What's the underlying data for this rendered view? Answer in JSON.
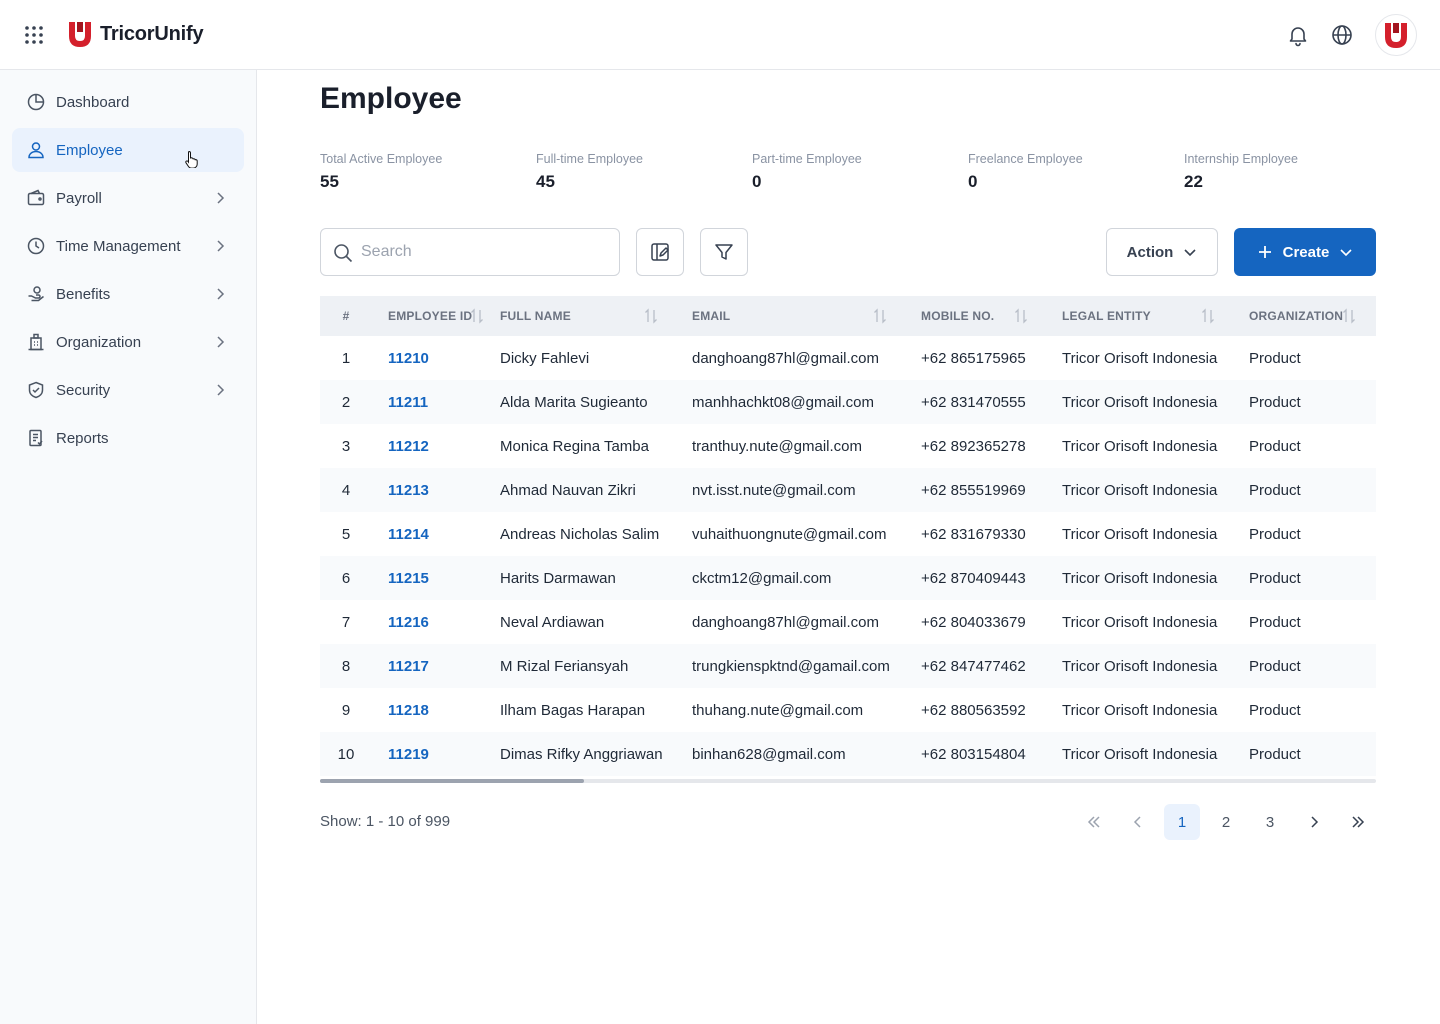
{
  "header": {
    "brand": "TricorUnify",
    "icons": [
      "apps-grid-icon",
      "bell-icon",
      "globe-icon",
      "avatar"
    ]
  },
  "sidebar": {
    "items": [
      {
        "label": "Dashboard",
        "icon": "dashboard-icon",
        "active": false,
        "has_children": false
      },
      {
        "label": "Employee",
        "icon": "user-icon",
        "active": true,
        "has_children": false
      },
      {
        "label": "Payroll",
        "icon": "wallet-icon",
        "active": false,
        "has_children": true
      },
      {
        "label": "Time Management",
        "icon": "clock-icon",
        "active": false,
        "has_children": true
      },
      {
        "label": "Benefits",
        "icon": "benefits-icon",
        "active": false,
        "has_children": true
      },
      {
        "label": "Organization",
        "icon": "building-icon",
        "active": false,
        "has_children": true
      },
      {
        "label": "Security",
        "icon": "shield-icon",
        "active": false,
        "has_children": true
      },
      {
        "label": "Reports",
        "icon": "report-icon",
        "active": false,
        "has_children": false
      }
    ]
  },
  "page": {
    "title": "Employee"
  },
  "stats": [
    {
      "label": "Total Active Employee",
      "value": "55"
    },
    {
      "label": "Full-time Employee",
      "value": "45"
    },
    {
      "label": "Part-time Employee",
      "value": "0"
    },
    {
      "label": "Freelance Employee",
      "value": "0"
    },
    {
      "label": "Internship Employee",
      "value": "22"
    }
  ],
  "toolbar": {
    "search_placeholder": "Search",
    "action_label": "Action",
    "create_label": "Create"
  },
  "table": {
    "headers": {
      "index": "#",
      "employee_id": "EMPLOYEE ID",
      "full_name": "FULL NAME",
      "email": "EMAIL",
      "mobile": "MOBILE NO.",
      "legal_entity": "LEGAL ENTITY",
      "organization": "ORGANIZATION"
    },
    "rows": [
      {
        "index": "1",
        "id": "11210",
        "name": "Dicky Fahlevi",
        "email": "danghoang87hl@gmail.com",
        "mobile": "+62 865175965",
        "entity": "Tricor Orisoft Indonesia",
        "org": "Product"
      },
      {
        "index": "2",
        "id": "11211",
        "name": "Alda Marita Sugieanto",
        "email": "manhhachkt08@gmail.com",
        "mobile": "+62 831470555",
        "entity": "Tricor Orisoft Indonesia",
        "org": "Product"
      },
      {
        "index": "3",
        "id": "11212",
        "name": "Monica Regina Tamba",
        "email": "tranthuy.nute@gmail.com",
        "mobile": "+62 892365278",
        "entity": "Tricor Orisoft Indonesia",
        "org": "Product"
      },
      {
        "index": "4",
        "id": "11213",
        "name": "Ahmad Nauvan Zikri",
        "email": "nvt.isst.nute@gmail.com",
        "mobile": "+62 855519969",
        "entity": "Tricor Orisoft Indonesia",
        "org": "Product"
      },
      {
        "index": "5",
        "id": "11214",
        "name": "Andreas Nicholas Salim",
        "email": "vuhaithuongnute@gmail.com",
        "mobile": "+62 831679330",
        "entity": "Tricor Orisoft Indonesia",
        "org": "Product"
      },
      {
        "index": "6",
        "id": "11215",
        "name": "Harits Darmawan",
        "email": "ckctm12@gmail.com",
        "mobile": "+62 870409443",
        "entity": "Tricor Orisoft Indonesia",
        "org": "Product"
      },
      {
        "index": "7",
        "id": "11216",
        "name": "Neval Ardiawan",
        "email": "danghoang87hl@gmail.com",
        "mobile": "+62 804033679",
        "entity": "Tricor Orisoft Indonesia",
        "org": "Product"
      },
      {
        "index": "8",
        "id": "11217",
        "name": "M Rizal Feriansyah",
        "email": "trungkienspktnd@gamail.com",
        "mobile": "+62 847477462",
        "entity": "Tricor Orisoft Indonesia",
        "org": "Product"
      },
      {
        "index": "9",
        "id": "11218",
        "name": "Ilham Bagas Harapan",
        "email": "thuhang.nute@gmail.com",
        "mobile": "+62 880563592",
        "entity": "Tricor Orisoft Indonesia",
        "org": "Product"
      },
      {
        "index": "10",
        "id": "11219",
        "name": "Dimas Rifky Anggriawan",
        "email": "binhan628@gmail.com",
        "mobile": "+62 803154804",
        "entity": "Tricor Orisoft Indonesia",
        "org": "Product"
      }
    ]
  },
  "pagination": {
    "showing": "Show: 1 - 10 of 999",
    "pages": [
      "1",
      "2",
      "3"
    ],
    "current": "1"
  },
  "colors": {
    "primary": "#1565c0",
    "active_bg": "#eaf2fd",
    "brand_red": "#d4202c"
  }
}
